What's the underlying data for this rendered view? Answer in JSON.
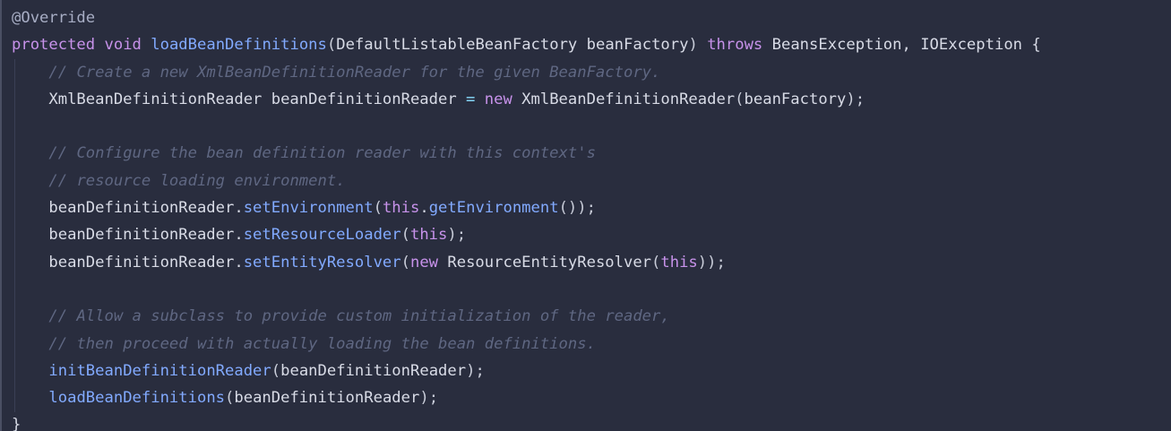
{
  "colors": {
    "background": "#292d3e",
    "keyword": "#c792ea",
    "method": "#82aaff",
    "comment": "#5f6782",
    "plain": "#d8dbe6",
    "operator": "#89ddff"
  },
  "code": {
    "lines": [
      [
        {
          "t": "annotation",
          "v": "@Override"
        }
      ],
      [
        {
          "t": "keyword",
          "v": "protected"
        },
        {
          "t": "plain",
          "v": " "
        },
        {
          "t": "keyword",
          "v": "void"
        },
        {
          "t": "plain",
          "v": " "
        },
        {
          "t": "method",
          "v": "loadBeanDefinitions"
        },
        {
          "t": "punct",
          "v": "("
        },
        {
          "t": "type",
          "v": "DefaultListableBeanFactory"
        },
        {
          "t": "plain",
          "v": " beanFactory"
        },
        {
          "t": "punct",
          "v": ")"
        },
        {
          "t": "plain",
          "v": " "
        },
        {
          "t": "keyword",
          "v": "throws"
        },
        {
          "t": "plain",
          "v": " BeansException, IOException {"
        }
      ],
      [
        {
          "t": "plain",
          "v": "    "
        },
        {
          "t": "comment",
          "v": "// Create a new XmlBeanDefinitionReader for the given BeanFactory."
        }
      ],
      [
        {
          "t": "plain",
          "v": "    XmlBeanDefinitionReader beanDefinitionReader "
        },
        {
          "t": "operator",
          "v": "="
        },
        {
          "t": "plain",
          "v": " "
        },
        {
          "t": "keyword",
          "v": "new"
        },
        {
          "t": "plain",
          "v": " XmlBeanDefinitionReader"
        },
        {
          "t": "punct",
          "v": "("
        },
        {
          "t": "plain",
          "v": "beanFactory"
        },
        {
          "t": "punct",
          "v": ");"
        }
      ],
      [
        {
          "t": "plain",
          "v": ""
        }
      ],
      [
        {
          "t": "plain",
          "v": "    "
        },
        {
          "t": "comment",
          "v": "// Configure the bean definition reader with this context's"
        }
      ],
      [
        {
          "t": "plain",
          "v": "    "
        },
        {
          "t": "comment",
          "v": "// resource loading environment."
        }
      ],
      [
        {
          "t": "plain",
          "v": "    beanDefinitionReader."
        },
        {
          "t": "method",
          "v": "setEnvironment"
        },
        {
          "t": "punct",
          "v": "("
        },
        {
          "t": "keyword",
          "v": "this"
        },
        {
          "t": "plain",
          "v": "."
        },
        {
          "t": "method",
          "v": "getEnvironment"
        },
        {
          "t": "punct",
          "v": "());"
        }
      ],
      [
        {
          "t": "plain",
          "v": "    beanDefinitionReader."
        },
        {
          "t": "method",
          "v": "setResourceLoader"
        },
        {
          "t": "punct",
          "v": "("
        },
        {
          "t": "keyword",
          "v": "this"
        },
        {
          "t": "punct",
          "v": ");"
        }
      ],
      [
        {
          "t": "plain",
          "v": "    beanDefinitionReader."
        },
        {
          "t": "method",
          "v": "setEntityResolver"
        },
        {
          "t": "punct",
          "v": "("
        },
        {
          "t": "keyword",
          "v": "new"
        },
        {
          "t": "plain",
          "v": " ResourceEntityResolver"
        },
        {
          "t": "punct",
          "v": "("
        },
        {
          "t": "keyword",
          "v": "this"
        },
        {
          "t": "punct",
          "v": "));"
        }
      ],
      [
        {
          "t": "plain",
          "v": ""
        }
      ],
      [
        {
          "t": "plain",
          "v": "    "
        },
        {
          "t": "comment",
          "v": "// Allow a subclass to provide custom initialization of the reader,"
        }
      ],
      [
        {
          "t": "plain",
          "v": "    "
        },
        {
          "t": "comment",
          "v": "// then proceed with actually loading the bean definitions."
        }
      ],
      [
        {
          "t": "plain",
          "v": "    "
        },
        {
          "t": "method",
          "v": "initBeanDefinitionReader"
        },
        {
          "t": "punct",
          "v": "("
        },
        {
          "t": "plain",
          "v": "beanDefinitionReader"
        },
        {
          "t": "punct",
          "v": ");"
        }
      ],
      [
        {
          "t": "plain",
          "v": "    "
        },
        {
          "t": "method",
          "v": "loadBeanDefinitions"
        },
        {
          "t": "punct",
          "v": "("
        },
        {
          "t": "plain",
          "v": "beanDefinitionReader"
        },
        {
          "t": "punct",
          "v": ");"
        }
      ],
      [
        {
          "t": "plain",
          "v": "}"
        }
      ]
    ]
  }
}
